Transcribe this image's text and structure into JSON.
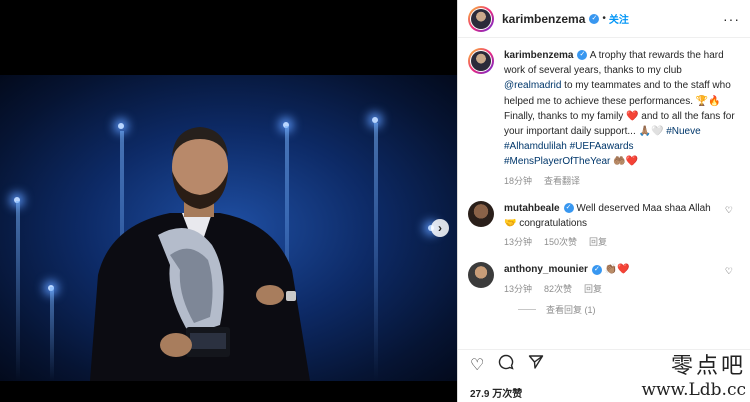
{
  "post": {
    "username": "karimbenzema",
    "follow_label": "关注",
    "more_icon": "more-options-icon",
    "caption": {
      "text_1": "A trophy that rewards the hard work of several years, thanks to my club ",
      "mention_club": "@realmadrid",
      "text_2": " to my teammates and to the staff who helped me to achieve these performances. ",
      "emoji_1": "🏆🔥",
      "text_3": "Finally, thanks to my family ",
      "emoji_2": "❤️",
      "text_4": " and to all the fans for your important daily support... ",
      "emoji_3": "🙏🏽🤍",
      "tag_1": "#Nueve",
      "tag_2": "#Alhamdulilah",
      "tag_3": "#UEFAawards",
      "tag_4": "#MensPlayerOfTheYear",
      "emoji_4": "🤲🏽❤️",
      "time": "18分钟",
      "translate": "查看翻译"
    }
  },
  "comments": [
    {
      "username": "mutahbeale",
      "text_1": "Well deserved Maa shaa Allah ",
      "text_2": "🤝 congratulations",
      "time": "13分钟",
      "likes": "150次赞",
      "reply": "回复"
    },
    {
      "username": "anthony_mounier",
      "emoji": "👏🏽❤️",
      "time": "13分钟",
      "likes": "82次赞",
      "reply": "回复",
      "view_replies": "查看回复 (1)"
    }
  ],
  "actions": {
    "like_icon": "heart-icon",
    "comment_icon": "comment-icon",
    "share_icon": "share-icon"
  },
  "likes_count": "27.9 万次赞",
  "watermark": {
    "cn": "零点吧",
    "url": "www.Ldb.cc"
  }
}
